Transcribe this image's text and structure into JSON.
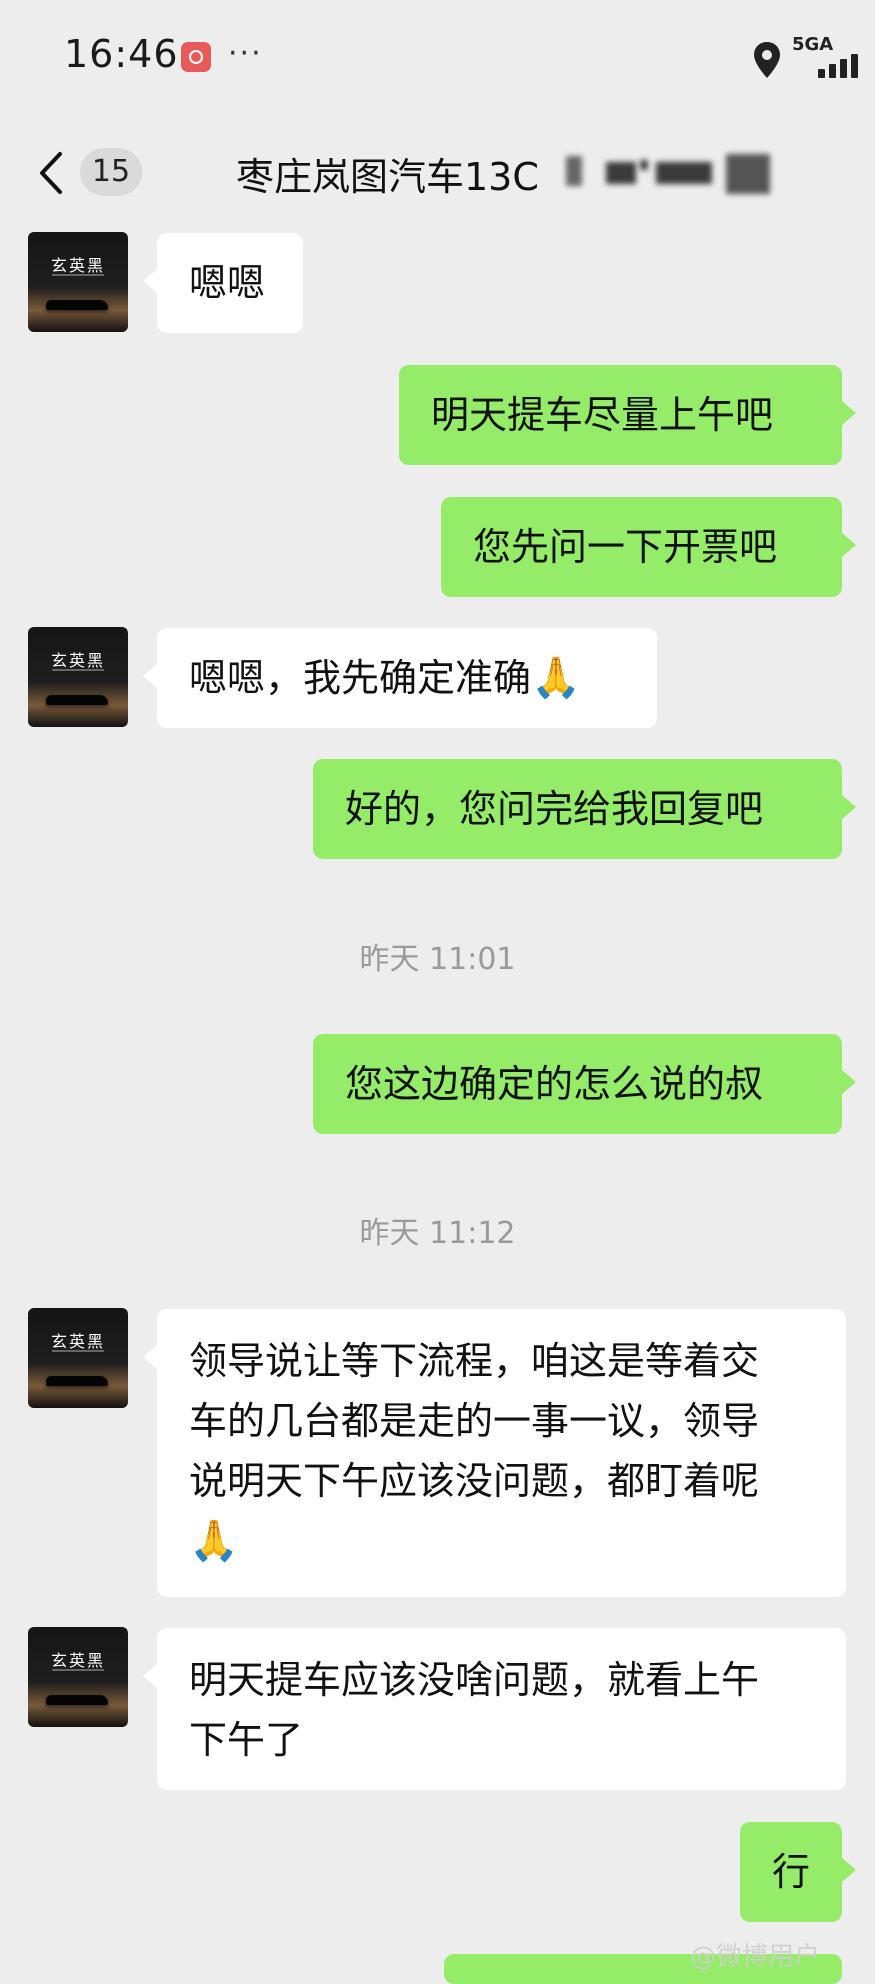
{
  "status_bar": {
    "time": "16:46",
    "more": "···",
    "network": "5GA",
    "icons": [
      "app-icon",
      "location-icon",
      "signal-icon"
    ]
  },
  "nav": {
    "back_count": "15",
    "title": "枣庄岚图汽车13C"
  },
  "avatar_brand": "玄英黑",
  "messages": [
    {
      "from": "contact",
      "text": "嗯嗯"
    },
    {
      "from": "me",
      "text": "明天提车尽量上午吧"
    },
    {
      "from": "me",
      "text": "您先问一下开票吧"
    },
    {
      "from": "contact",
      "text": "嗯嗯，我先确定准确",
      "emoji": "🙏"
    },
    {
      "from": "me",
      "text": "好的，您问完给我回复吧"
    },
    {
      "type": "time",
      "text": "昨天 11:01"
    },
    {
      "from": "me",
      "text": "您这边确定的怎么说的叔"
    },
    {
      "type": "time",
      "text": "昨天 11:12"
    },
    {
      "from": "contact",
      "lines": [
        "领导说让等下流程，咱这是等着交",
        "车的几台都是走的一事一议，领导",
        "说明天下午应该没问题，都盯着呢"
      ],
      "emoji": "🙏"
    },
    {
      "from": "contact",
      "lines": [
        "明天提车应该没啥问题，就看上午",
        "下午了"
      ]
    },
    {
      "from": "me",
      "text": "行"
    }
  ],
  "colors": {
    "background": "#EDEDED",
    "outgoing_bubble": "#95EC69",
    "incoming_bubble": "#FFFFFF"
  },
  "watermark": "@微博用户"
}
